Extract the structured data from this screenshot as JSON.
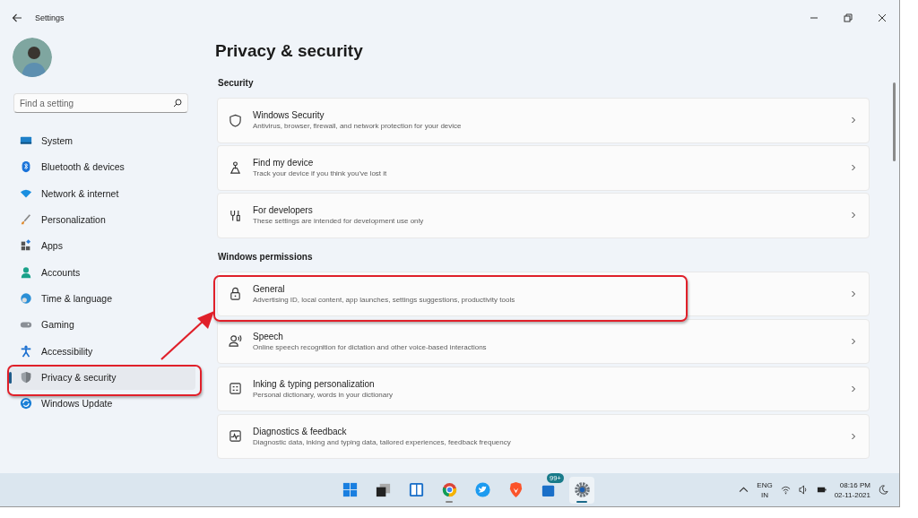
{
  "window": {
    "title": "Settings"
  },
  "sidebar": {
    "search": {
      "placeholder": "Find a setting"
    },
    "items": [
      {
        "label": "System",
        "kind": "system",
        "selected": false
      },
      {
        "label": "Bluetooth & devices",
        "kind": "bluetooth",
        "selected": false
      },
      {
        "label": "Network & internet",
        "kind": "network",
        "selected": false
      },
      {
        "label": "Personalization",
        "kind": "brush",
        "selected": false
      },
      {
        "label": "Apps",
        "kind": "apps",
        "selected": false
      },
      {
        "label": "Accounts",
        "kind": "accounts",
        "selected": false
      },
      {
        "label": "Time & language",
        "kind": "time",
        "selected": false
      },
      {
        "label": "Gaming",
        "kind": "gaming",
        "selected": false
      },
      {
        "label": "Accessibility",
        "kind": "accessibility",
        "selected": false
      },
      {
        "label": "Privacy & security",
        "kind": "privacy",
        "selected": true
      },
      {
        "label": "Windows Update",
        "kind": "update",
        "selected": false
      }
    ]
  },
  "page": {
    "title": "Privacy & security",
    "sections": [
      {
        "heading": "Security",
        "cards": [
          {
            "title": "Windows Security",
            "subtitle": "Antivirus, browser, firewall, and network protection for your device",
            "kind": "shield"
          },
          {
            "title": "Find my device",
            "subtitle": "Track your device if you think you've lost it",
            "kind": "person-pin"
          },
          {
            "title": "For developers",
            "subtitle": "These settings are intended for development use only",
            "kind": "tools"
          }
        ]
      },
      {
        "heading": "Windows permissions",
        "cards": [
          {
            "title": "General",
            "subtitle": "Advertising ID, local content, app launches, settings suggestions, productivity tools",
            "kind": "lock"
          },
          {
            "title": "Speech",
            "subtitle": "Online speech recognition for dictation and other voice-based interactions",
            "kind": "speech"
          },
          {
            "title": "Inking & typing personalization",
            "subtitle": "Personal dictionary, words in your dictionary",
            "kind": "dictionary"
          },
          {
            "title": "Diagnostics & feedback",
            "subtitle": "Diagnostic data, inking and typing data, tailored experiences, feedback frequency",
            "kind": "pulse"
          }
        ]
      }
    ]
  },
  "annotations": [
    {
      "kind": "box"
    },
    {
      "kind": "box"
    },
    {
      "kind": "arrow"
    }
  ],
  "taskbar": {
    "apps": [
      {
        "kind": "start",
        "selected": false,
        "running": false
      },
      {
        "kind": "taskview",
        "selected": false,
        "running": false
      },
      {
        "kind": "widgets",
        "selected": false,
        "running": false
      },
      {
        "kind": "chrome",
        "selected": false,
        "running": true
      },
      {
        "kind": "twitter",
        "selected": false,
        "running": false
      },
      {
        "kind": "brave",
        "selected": false,
        "running": false
      },
      {
        "kind": "store",
        "selected": false,
        "running": false,
        "badge": "99+"
      },
      {
        "kind": "settings",
        "selected": true,
        "running": true
      }
    ],
    "tray": {
      "language": "ENG",
      "region": "IN",
      "time": "08:16 PM",
      "date": "02-11-2021"
    }
  }
}
